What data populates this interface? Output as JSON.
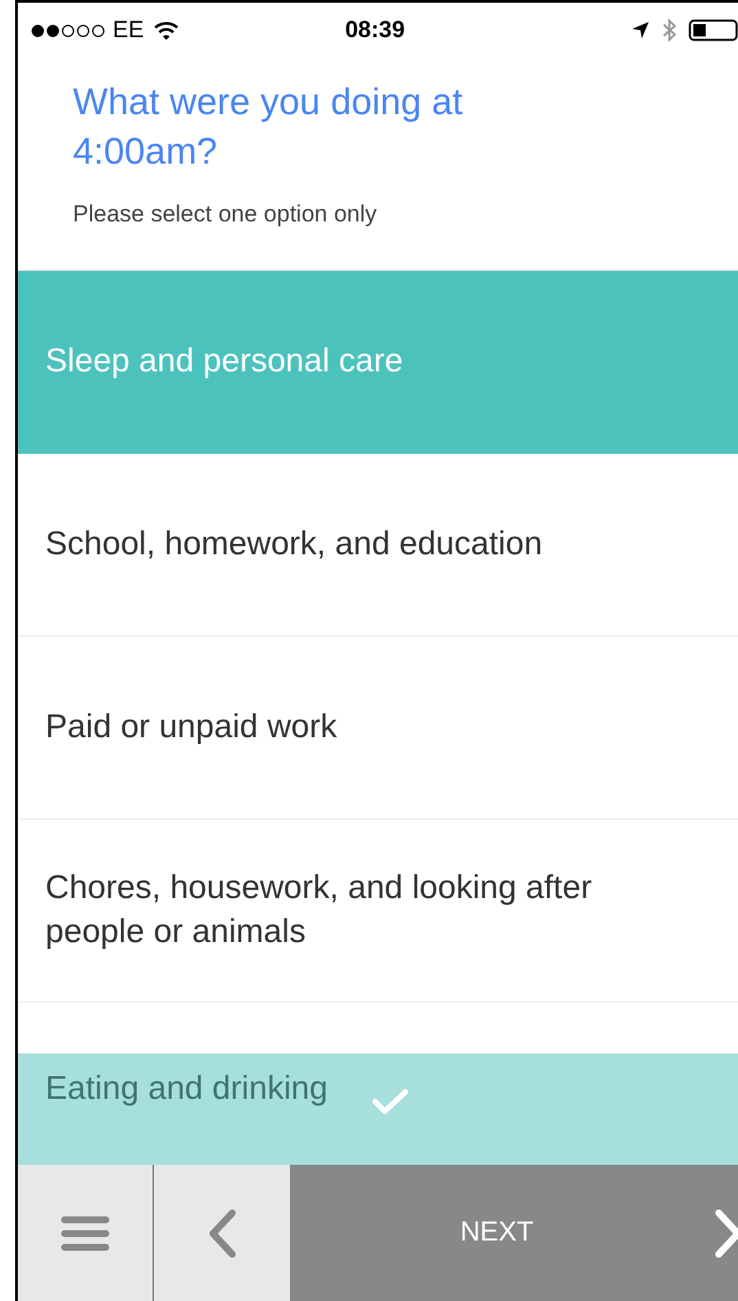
{
  "status_bar": {
    "carrier": "EE",
    "time": "08:39",
    "signal_dots": [
      {
        "filled": true
      },
      {
        "filled": true
      },
      {
        "filled": false
      },
      {
        "filled": false
      },
      {
        "filled": false
      }
    ]
  },
  "question": {
    "title": "What were you doing at 4:00am?",
    "instruction": "Please select one option only"
  },
  "options": [
    {
      "label": "Sleep and personal care",
      "selected": true
    },
    {
      "label": "School, homework, and education",
      "selected": false
    },
    {
      "label": "Paid or unpaid work",
      "selected": false
    },
    {
      "label": "Chores, housework, and looking after people or animals",
      "selected": false
    }
  ],
  "confirmation_bar": {
    "label": "Eating and drinking"
  },
  "toolbar": {
    "next_label": "NEXT"
  }
}
